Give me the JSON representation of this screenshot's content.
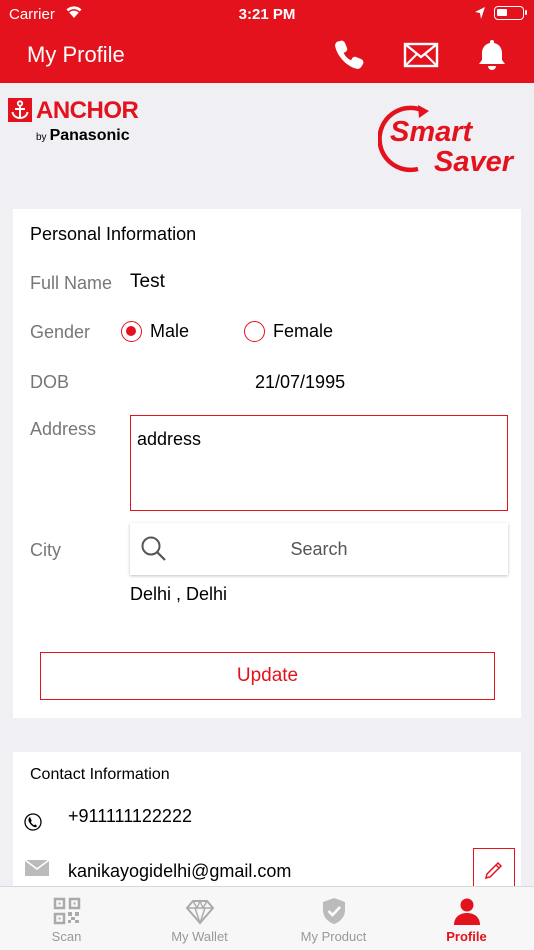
{
  "status_bar": {
    "carrier": "Carrier",
    "time": "3:21 PM"
  },
  "navbar": {
    "title": "My Profile",
    "icons": [
      "phone-icon",
      "mail-icon",
      "bell-icon"
    ],
    "color": "#e4121d"
  },
  "brand": {
    "anchor": "ANCHOR",
    "by": "by",
    "panasonic": "Panasonic",
    "smart_saver_line1": "Smart",
    "smart_saver_line2": "Saver"
  },
  "personal": {
    "title": "Personal Information",
    "full_name_label": "Full Name",
    "full_name_value": "Test",
    "gender_label": "Gender",
    "gender_options": [
      "Male",
      "Female"
    ],
    "gender_selected": "Male",
    "dob_label": "DOB",
    "dob_value": "21/07/1995",
    "address_label": "Address",
    "address_value": "address",
    "city_label": "City",
    "city_search_placeholder": "Search",
    "city_value": "Delhi , Delhi",
    "update_label": "Update"
  },
  "contact": {
    "title": "Contact Information",
    "phone": "+911111122222",
    "email": "kanikayogidelhi@gmail.com"
  },
  "tabs": [
    {
      "label": "Scan",
      "icon": "qr-code-icon",
      "active": false
    },
    {
      "label": "My Wallet",
      "icon": "diamond-icon",
      "active": false
    },
    {
      "label": "My Product",
      "icon": "shield-check-icon",
      "active": false
    },
    {
      "label": "Profile",
      "icon": "person-icon",
      "active": true
    }
  ]
}
